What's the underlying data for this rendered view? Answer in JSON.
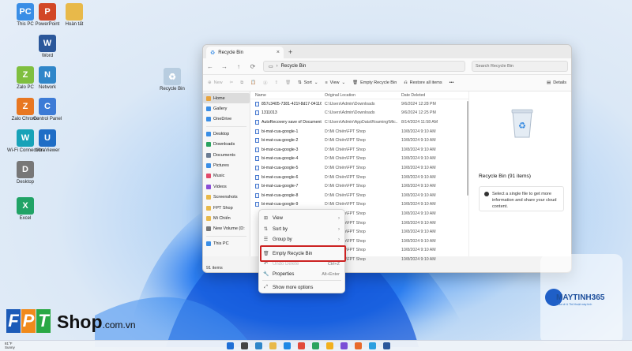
{
  "desktop_icons": [
    {
      "label": "This PC",
      "color": "#3a8ee6",
      "glyph": "PC"
    },
    {
      "label": "PowerPoint",
      "color": "#d24726",
      "glyph": "P"
    },
    {
      "label": "Hoàn tất",
      "color": "#e8b94a",
      "glyph": ""
    },
    {
      "label": "Word",
      "color": "#2b579a",
      "glyph": "W"
    },
    {
      "label": "Zalo PC",
      "color": "#7fbf3f",
      "glyph": "Z"
    },
    {
      "label": "Network",
      "color": "#2f86c9",
      "glyph": "N"
    },
    {
      "label": "Recycle Bin",
      "color": "#b8cde0",
      "glyph": "♻"
    },
    {
      "label": "Zalo Chrome",
      "color": "#e87722",
      "glyph": "Z"
    },
    {
      "label": "Control Panel",
      "color": "#3d7bd6",
      "glyph": "C"
    },
    {
      "label": "Wi-Fi Connection",
      "color": "#17a2b8",
      "glyph": "W"
    },
    {
      "label": "UltraViewer",
      "color": "#1e6dc6",
      "glyph": "U"
    },
    {
      "label": "Desktop",
      "color": "#777777",
      "glyph": "D"
    },
    {
      "label": "Excel",
      "color": "#21a366",
      "glyph": "X"
    }
  ],
  "window": {
    "tab_title": "Recycle Bin",
    "new_tab_glyph": "+",
    "address": "Recycle Bin",
    "search_placeholder": "Search Recycle Bin",
    "toolbar": {
      "new": "New",
      "sort": "Sort",
      "view": "View",
      "empty": "Empty Recycle Bin",
      "restore": "Restore all items",
      "more": "•••",
      "details": "Details"
    },
    "nav_items": [
      {
        "label": "Home",
        "color": "#e8a33d",
        "selected": true
      },
      {
        "label": "Gallery",
        "color": "#3a8ee6"
      },
      {
        "label": "OneDrive",
        "color": "#3a8ee6"
      },
      {
        "label": "Desktop",
        "color": "#3a8ee6"
      },
      {
        "label": "Downloads",
        "color": "#2aa35f"
      },
      {
        "label": "Documents",
        "color": "#6b7c93"
      },
      {
        "label": "Pictures",
        "color": "#3a8ee6"
      },
      {
        "label": "Music",
        "color": "#e24a6b"
      },
      {
        "label": "Videos",
        "color": "#8a4fd6"
      },
      {
        "label": "Screenshots",
        "color": "#e8b94a"
      },
      {
        "label": "FPT Shop",
        "color": "#e8b94a"
      },
      {
        "label": "Mi Chiến",
        "color": "#e8b94a"
      },
      {
        "label": "New Volume (D:",
        "color": "#777777"
      },
      {
        "label": "This PC",
        "color": "#3a8ee6"
      }
    ],
    "columns": {
      "name": "Name",
      "location": "Original Location",
      "date": "Date Deleted"
    },
    "files": [
      {
        "name": "857c3405-7381-421f-8d17-04116be...",
        "location": "C:\\Users\\Admin\\Downloads",
        "date": "9/6/2024 12:28 PM"
      },
      {
        "name": "1311013",
        "location": "C:\\Users\\Admin\\Downloads",
        "date": "9/6/2024 12:25 PM"
      },
      {
        "name": "AutoRecovery save of Document2",
        "location": "C:\\Users\\Admin\\AppData\\Roaming\\Mic...",
        "date": "8/14/2024 11:58 AM"
      },
      {
        "name": "bi-mat-cua-google-1",
        "location": "D:\\Mi Chiến\\FPT Shop",
        "date": "10/8/2024 9:10 AM"
      },
      {
        "name": "bi-mat-cua-google-2",
        "location": "D:\\Mi Chiến\\FPT Shop",
        "date": "10/8/2024 9:10 AM"
      },
      {
        "name": "bi-mat-cua-google-3",
        "location": "D:\\Mi Chiến\\FPT Shop",
        "date": "10/8/2024 9:10 AM"
      },
      {
        "name": "bi-mat-cua-google-4",
        "location": "D:\\Mi Chiến\\FPT Shop",
        "date": "10/8/2024 9:10 AM"
      },
      {
        "name": "bi-mat-cua-google-5",
        "location": "D:\\Mi Chiến\\FPT Shop",
        "date": "10/8/2024 9:10 AM"
      },
      {
        "name": "bi-mat-cua-google-6",
        "location": "D:\\Mi Chiến\\FPT Shop",
        "date": "10/8/2024 9:10 AM"
      },
      {
        "name": "bi-mat-cua-google-7",
        "location": "D:\\Mi Chiến\\FPT Shop",
        "date": "10/8/2024 9:10 AM"
      },
      {
        "name": "bi-mat-cua-google-8",
        "location": "D:\\Mi Chiến\\FPT Shop",
        "date": "10/8/2024 9:10 AM"
      },
      {
        "name": "bi-mat-cua-google-9",
        "location": "D:\\Mi Chiến\\FPT Shop",
        "date": "10/8/2024 9:10 AM"
      },
      {
        "name": "",
        "location": "D:\\Mi Chiến\\FPT Shop",
        "date": "10/8/2024 9:10 AM"
      },
      {
        "name": "",
        "location": "D:\\Mi Chiến\\FPT Shop",
        "date": "10/8/2024 9:10 AM"
      },
      {
        "name": "",
        "location": "D:\\Mi Chiến\\FPT Shop",
        "date": "10/8/2024 9:10 AM"
      },
      {
        "name": "",
        "location": "D:\\Mi Chiến\\FPT Shop",
        "date": "10/8/2024 9:10 AM"
      },
      {
        "name": "",
        "location": "D:\\Mi Chiến\\FPT Shop",
        "date": "10/8/2024 9:10 AM"
      },
      {
        "name": "",
        "location": "D:\\Mi Chiến\\FPT Shop",
        "date": "10/8/2024 9:10 AM"
      }
    ],
    "preview": {
      "title": "Recycle Bin (91 items)",
      "hint": "Select a single file to get more information and share your cloud content."
    },
    "status": "91 items"
  },
  "context_menu": {
    "items": [
      {
        "label": "View",
        "icon": "grid-icon",
        "glyph": "⊞",
        "arrow": "›"
      },
      {
        "label": "Sort by",
        "icon": "sort-icon",
        "glyph": "⇅",
        "arrow": "›"
      },
      {
        "label": "Group by",
        "icon": "group-icon",
        "glyph": "☰",
        "arrow": "›"
      },
      {
        "label": "Empty Recycle Bin",
        "icon": "recycle-bin-icon",
        "glyph": "🗑"
      },
      {
        "label": "Undo Delete",
        "icon": "undo-icon",
        "glyph": "↶",
        "shortcut": "Ctrl+Z"
      },
      {
        "label": "Properties",
        "icon": "properties-icon",
        "glyph": "🔧",
        "shortcut": "Alt+Enter"
      },
      {
        "label": "Show more options",
        "icon": "more-options-icon",
        "glyph": "⤢"
      }
    ]
  },
  "watermark": {
    "fpt_letters": [
      "F",
      "P",
      "T"
    ],
    "fpt_shop": "Shop",
    "fpt_domain": ".com.vn",
    "mt_brand": "MAYTINH365",
    "mt_tag": "Chia sẻ & Thủ thuật máy tính"
  },
  "taskbar": {
    "weather": "81°F",
    "weather_sub": "Sunny"
  },
  "colors": {
    "accent": "#0a64d8",
    "highlight_border": "#cc2222"
  }
}
